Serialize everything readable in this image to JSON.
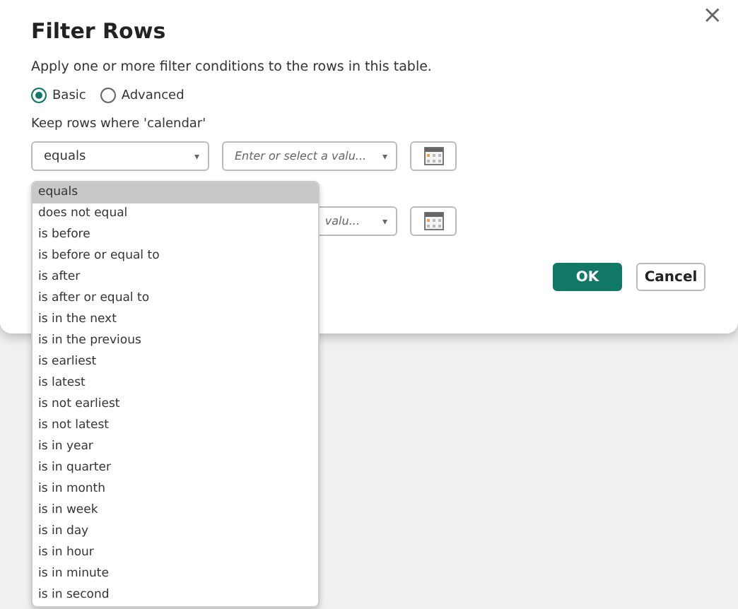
{
  "dialog": {
    "title": "Filter Rows",
    "close": "×",
    "description": "Apply one or more filter conditions to the rows in this table.",
    "modes": [
      {
        "label": "Basic",
        "selected": true
      },
      {
        "label": "Advanced",
        "selected": false
      }
    ],
    "keep_label": "Keep rows where 'calendar'",
    "conditions": [
      {
        "operator": "equals",
        "value_placeholder": "Enter or select a valu...",
        "caret": "▾"
      },
      {
        "value_placeholder": "valu...",
        "caret": "▾"
      }
    ],
    "buttons": [
      {
        "label": "OK",
        "kind": "primary"
      },
      {
        "label": "Cancel",
        "kind": "secondary"
      }
    ]
  },
  "operator_list": [
    {
      "label": "equals",
      "selected": true
    },
    {
      "label": "does not equal",
      "selected": false
    },
    {
      "label": "is before",
      "selected": false
    },
    {
      "label": "is before or equal to",
      "selected": false
    },
    {
      "label": "is after",
      "selected": false
    },
    {
      "label": "is after or equal to",
      "selected": false
    },
    {
      "label": "is in the next",
      "selected": false
    },
    {
      "label": "is in the previous",
      "selected": false
    },
    {
      "label": "is earliest",
      "selected": false
    },
    {
      "label": "is latest",
      "selected": false
    },
    {
      "label": "is not earliest",
      "selected": false
    },
    {
      "label": "is not latest",
      "selected": false
    },
    {
      "label": "is in year",
      "selected": false
    },
    {
      "label": "is in quarter",
      "selected": false
    },
    {
      "label": "is in month",
      "selected": false
    },
    {
      "label": "is in week",
      "selected": false
    },
    {
      "label": "is in day",
      "selected": false
    },
    {
      "label": "is in hour",
      "selected": false
    },
    {
      "label": "is in minute",
      "selected": false
    },
    {
      "label": "is in second",
      "selected": false
    }
  ]
}
